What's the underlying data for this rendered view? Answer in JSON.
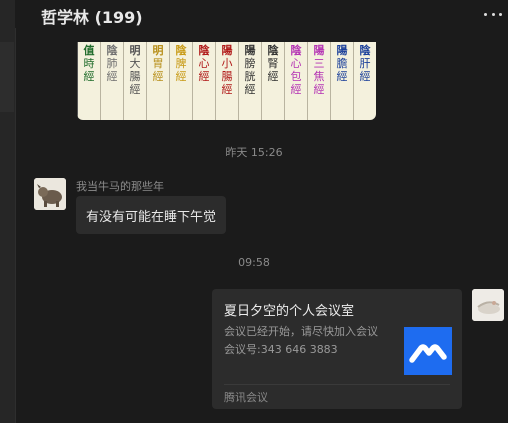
{
  "chat": {
    "title": "哲学林 (199)",
    "more_icon": "more-horizontal-icon"
  },
  "meridians": [
    {
      "top": "值",
      "text": "時經",
      "color": "#1f6b2a"
    },
    {
      "top": "陰",
      "text": "肺經",
      "color": "#707070"
    },
    {
      "top": "明",
      "text": "大腸經",
      "color": "#555555"
    },
    {
      "top": "明",
      "text": "胃經",
      "color": "#b8901c"
    },
    {
      "top": "陰",
      "text": "脾經",
      "color": "#c89a14"
    },
    {
      "top": "陰",
      "text": "心經",
      "color": "#b01818"
    },
    {
      "top": "陽",
      "text": "小腸經",
      "color": "#b01818"
    },
    {
      "top": "陽",
      "text": "膀胱經",
      "color": "#333333"
    },
    {
      "top": "陰",
      "text": "腎經",
      "color": "#333333"
    },
    {
      "top": "陰",
      "text": "心包經",
      "color": "#b434b4"
    },
    {
      "top": "陽",
      "text": "三焦經",
      "color": "#b434b4"
    },
    {
      "top": "陽",
      "text": "膽經",
      "color": "#1a3f9a"
    },
    {
      "top": "陰",
      "text": "肝經",
      "color": "#1a3f9a"
    }
  ],
  "messages": {
    "timestamp1": "昨天 15:26",
    "sender_name": "我当牛马的那些年",
    "text1": "有没有可能在睡下午觉",
    "timestamp2": "09:58",
    "card": {
      "title": "夏日夕空的个人会议室",
      "line1": "会议已经开始，请尽快加入会议",
      "line2": "会议号:343 646 3883",
      "source": "腾讯会议",
      "brand_color": "#1e6cf0",
      "thumb_icon": "tencent-meeting-logo-icon"
    }
  }
}
